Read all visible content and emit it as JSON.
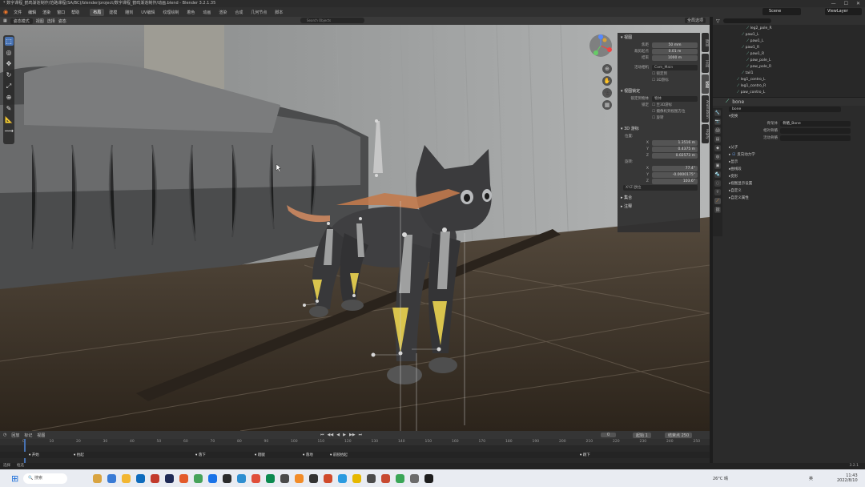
{
  "titlebar": {
    "title": "* 数字课程_鹤鸣渐逝制作/范路课程(SA/BC)/blender/project/数字课程_鹤鸣渐逝制作/动画.blend - Blender 3.2.1.35"
  },
  "window_controls": {
    "minimize": "—",
    "maximize": "☐",
    "close": "✕"
  },
  "menubar": {
    "menus": [
      "文件",
      "编辑",
      "渲染",
      "窗口",
      "帮助"
    ],
    "workspaces": [
      "布局",
      "建模",
      "雕刻",
      "UV编辑",
      "纹理绘制",
      "着色",
      "动画",
      "渲染",
      "合成",
      "几何节点",
      "脚本"
    ],
    "active_workspace": "布局",
    "scene": "Scene",
    "view_layer": "ViewLayer"
  },
  "viewport_header": {
    "mode": "姿态模式",
    "items": [
      "视图",
      "选择",
      "姿态"
    ],
    "search_placeholder": "Search Objects",
    "shading": "全局选项"
  },
  "toolbar": {
    "tools": [
      "select",
      "cursor",
      "move",
      "rotate",
      "scale",
      "transform",
      "annotate",
      "measure",
      "pose"
    ]
  },
  "npanel": {
    "section_view": "视图",
    "rows": [
      {
        "label": "焦距",
        "value": "50 mm"
      },
      {
        "label": "裁剪起点",
        "value": "0.01 m"
      },
      {
        "label": "结束",
        "value": "1000 m"
      }
    ],
    "local_camera_label": "活动相机",
    "local_camera_value": "Cam_Main",
    "checks": [
      "锁定到",
      "3D游标"
    ],
    "section_lock": "视图锁定",
    "lock_object_label": "锁定到物体",
    "lock_object_value": "物体",
    "lock_label": "锁定",
    "lock_options": [
      "至3D游标",
      "摄像机到视图方位",
      "旋转"
    ],
    "section_cursor": "3D 游标",
    "location_label": "位置:",
    "cursor_loc": [
      {
        "axis": "X",
        "value": "1.3516 m"
      },
      {
        "axis": "Y",
        "value": "0.4375 m"
      },
      {
        "axis": "Z",
        "value": "0.02573 m"
      }
    ],
    "rotation_label": "旋转:",
    "cursor_rot": [
      {
        "axis": "X",
        "value": "77.4°"
      },
      {
        "axis": "Y",
        "value": "-0.0000175°"
      },
      {
        "axis": "Z",
        "value": "103.6°"
      }
    ],
    "rot_mode": "XYZ 欧拉",
    "section_collections": "集合",
    "section_annotations": "注释",
    "tabs": [
      "项目",
      "工具",
      "视图",
      "Animation",
      "Rigify"
    ]
  },
  "outliner": {
    "search_placeholder": "",
    "rows": [
      {
        "name": "leg2_pole_R",
        "indent": 7
      },
      {
        "name": "paw1_L",
        "indent": 6
      },
      {
        "name": "paw1_L",
        "indent": 7
      },
      {
        "name": "paw1_R",
        "indent": 6
      },
      {
        "name": "paw1_R",
        "indent": 7
      },
      {
        "name": "paw_pole_L",
        "indent": 7
      },
      {
        "name": "paw_pole_R",
        "indent": 7
      },
      {
        "name": "tail1",
        "indent": 6
      },
      {
        "name": "leg1_contro_L",
        "indent": 5
      },
      {
        "name": "leg1_contro_R",
        "indent": 5
      },
      {
        "name": "paw_contro_L",
        "indent": 5
      }
    ]
  },
  "properties": {
    "object_name": "bone",
    "datablock": "bone",
    "section_transform": "变换",
    "parent_label": "骨架体",
    "parent_value": "骨骼_Bone",
    "relation_label": "相对骨骼",
    "relation_value": "",
    "offset_label": "活动骨骼",
    "offset_value": "",
    "sections": [
      "父子",
      "显示",
      "曲线段",
      "变形",
      "视图显示设置",
      "自定义",
      "自定义属性"
    ],
    "inverse_kinematics_checked": true
  },
  "timeline": {
    "menus": [
      "回放",
      "标记",
      "视图"
    ],
    "current_frame": "0",
    "start": "1",
    "end": "250",
    "start_label": "起始",
    "end_label": "结束点",
    "ticks": [
      "0",
      "10",
      "20",
      "30",
      "40",
      "50",
      "60",
      "70",
      "80",
      "90",
      "100",
      "110",
      "120",
      "130",
      "140",
      "150",
      "160",
      "170",
      "180",
      "190",
      "200",
      "210",
      "220",
      "230",
      "240",
      "250"
    ],
    "markers": [
      "开始",
      "抬起",
      "落下",
      "蹬腿",
      "落地",
      "前肢抬起",
      "跳下"
    ]
  },
  "statusbar": {
    "left": "选择",
    "mid": "框选",
    "right": "3.2.1"
  },
  "taskbar": {
    "search_placeholder": "搜索",
    "weather": "26°C 晴",
    "time": "11:43",
    "date": "2022/8/10",
    "lang": "英"
  }
}
